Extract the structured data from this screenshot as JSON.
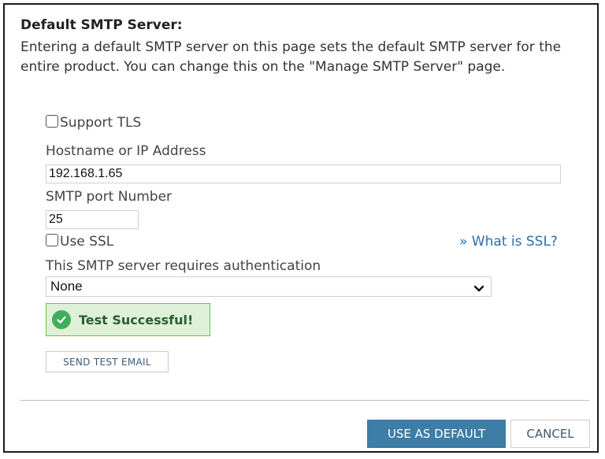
{
  "dialog": {
    "title": "Default SMTP Server:",
    "description": "Entering a default SMTP server on this page sets the default SMTP server for the entire product. You can change this on the \"Manage SMTP Server\" page."
  },
  "form": {
    "support_tls": {
      "label": "Support TLS",
      "checked": false
    },
    "hostname": {
      "label": "Hostname or IP Address",
      "value": "192.168.1.65"
    },
    "port": {
      "label": "SMTP port Number",
      "value": "25"
    },
    "use_ssl": {
      "label": "Use SSL",
      "checked": false
    },
    "ssl_help_link": "» What is SSL?",
    "auth": {
      "label": "This SMTP server requires authentication",
      "selected": "None"
    }
  },
  "status": {
    "message": "Test Successful!",
    "color": "#3fae5a"
  },
  "buttons": {
    "send_test": "SEND TEST EMAIL",
    "use_default": "USE AS DEFAULT",
    "cancel": "CANCEL"
  },
  "colors": {
    "primary": "#3d7da6",
    "link": "#2a6fa8",
    "success_bg": "#dff0d8"
  }
}
